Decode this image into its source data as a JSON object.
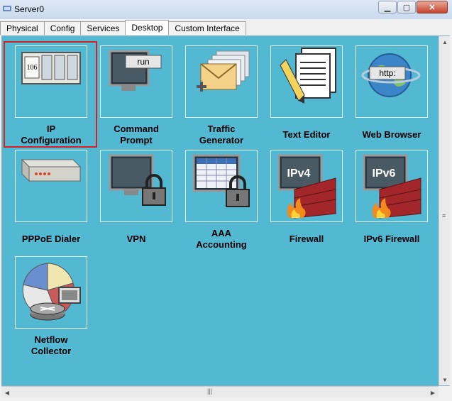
{
  "window": {
    "title": "Server0"
  },
  "tabs": [
    {
      "label": "Physical"
    },
    {
      "label": "Config"
    },
    {
      "label": "Services"
    },
    {
      "label": "Desktop"
    },
    {
      "label": "Custom Interface"
    }
  ],
  "active_tab": "Desktop",
  "apps": [
    {
      "line1": "IP",
      "line2": "Configuration",
      "icon": "ip-configuration-icon",
      "ip_text": "106"
    },
    {
      "line1": "Command",
      "line2": "Prompt",
      "icon": "command-prompt-icon",
      "run_text": "run"
    },
    {
      "line1": "Traffic",
      "line2": "Generator",
      "icon": "traffic-generator-icon"
    },
    {
      "line1": "",
      "line2": "Text Editor",
      "icon": "text-editor-icon"
    },
    {
      "line1": "",
      "line2": "Web Browser",
      "icon": "web-browser-icon",
      "http_text": "http:"
    },
    {
      "line1": "",
      "line2": "PPPoE Dialer",
      "icon": "pppoe-dialer-icon"
    },
    {
      "line1": "",
      "line2": "VPN",
      "icon": "vpn-icon"
    },
    {
      "line1": "AAA",
      "line2": "Accounting",
      "icon": "aaa-accounting-icon"
    },
    {
      "line1": "",
      "line2": "Firewall",
      "icon": "firewall-icon",
      "badge": "IPv4"
    },
    {
      "line1": "",
      "line2": "IPv6 Firewall",
      "icon": "ipv6-firewall-icon",
      "badge": "IPv6"
    },
    {
      "line1": "Netflow",
      "line2": "Collector",
      "icon": "netflow-collector-icon"
    }
  ],
  "selected_app": "IP Configuration",
  "colors": {
    "desktop_bg": "#53b8d2",
    "selection": "#d32020"
  }
}
